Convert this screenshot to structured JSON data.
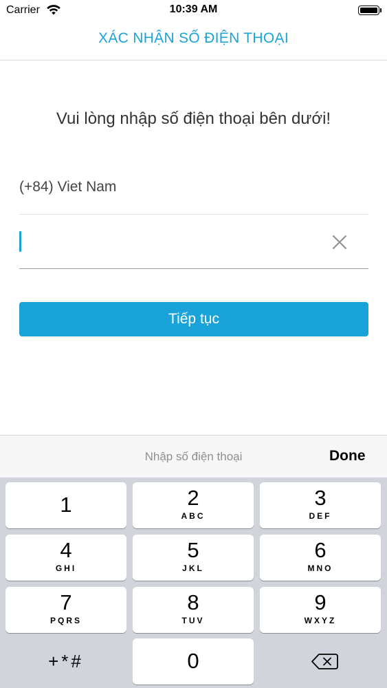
{
  "status_bar": {
    "carrier": "Carrier",
    "time": "10:39 AM"
  },
  "nav": {
    "title": "XÁC NHẬN SỐ ĐIỆN THOẠI"
  },
  "form": {
    "instruction": "Vui lòng nhập số điện thoại bên dưới!",
    "country": "(+84) Viet Nam",
    "phone_value": "",
    "continue_label": "Tiếp tục"
  },
  "keyboard": {
    "accessory_placeholder": "Nhập số điện thoại",
    "done_label": "Done",
    "keys": [
      {
        "digit": "1",
        "letters": ""
      },
      {
        "digit": "2",
        "letters": "ABC"
      },
      {
        "digit": "3",
        "letters": "DEF"
      },
      {
        "digit": "4",
        "letters": "GHI"
      },
      {
        "digit": "5",
        "letters": "JKL"
      },
      {
        "digit": "6",
        "letters": "MNO"
      },
      {
        "digit": "7",
        "letters": "PQRS"
      },
      {
        "digit": "8",
        "letters": "TUV"
      },
      {
        "digit": "9",
        "letters": "WXYZ"
      },
      {
        "digit": "0",
        "letters": ""
      }
    ],
    "symbols_label": "+*#"
  },
  "colors": {
    "accent": "#1aa3d9",
    "keypad_background": "#d1d5db",
    "accessory_background": "#f7f7f7"
  },
  "icons": {
    "wifi": "wifi-icon",
    "battery": "battery-icon",
    "clear": "close-icon",
    "delete": "backspace-icon"
  }
}
